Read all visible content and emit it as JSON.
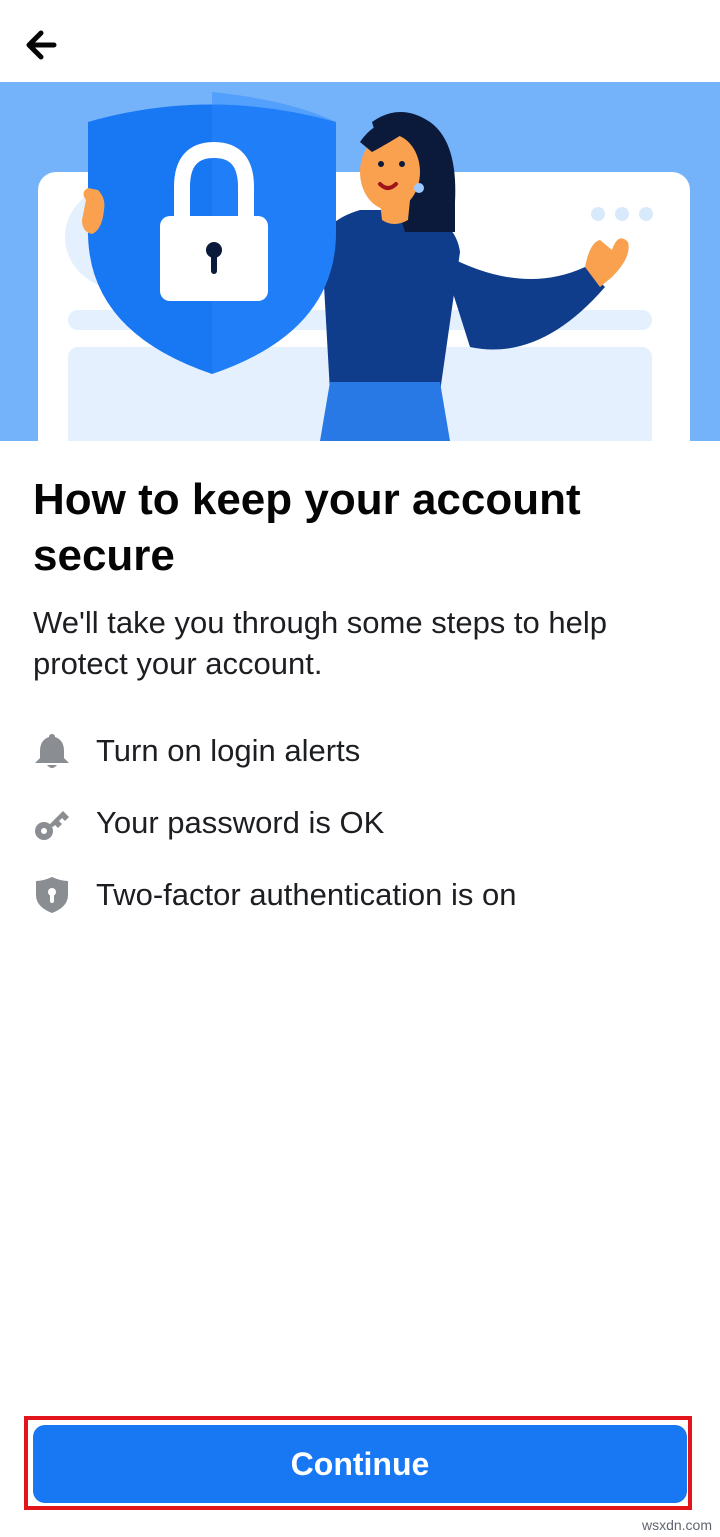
{
  "header": {
    "back_icon": "arrow-left-icon"
  },
  "hero": {
    "illustration": "woman holding shield with padlock"
  },
  "main": {
    "title": "How to keep your account secure",
    "subtitle": "We'll take you through some steps to help protect your account.",
    "steps": [
      {
        "icon": "bell-icon",
        "label": "Turn on login alerts"
      },
      {
        "icon": "key-icon",
        "label": "Your password is OK"
      },
      {
        "icon": "shield-lock-icon",
        "label": "Two-factor authentication is on"
      }
    ]
  },
  "footer": {
    "continue_label": "Continue"
  },
  "watermark": "wsxdn.com",
  "colors": {
    "accent": "#1877f2",
    "hero_background": "#74b3fa",
    "highlight_border": "#e0161c",
    "icon_gray": "#8a8d91"
  }
}
